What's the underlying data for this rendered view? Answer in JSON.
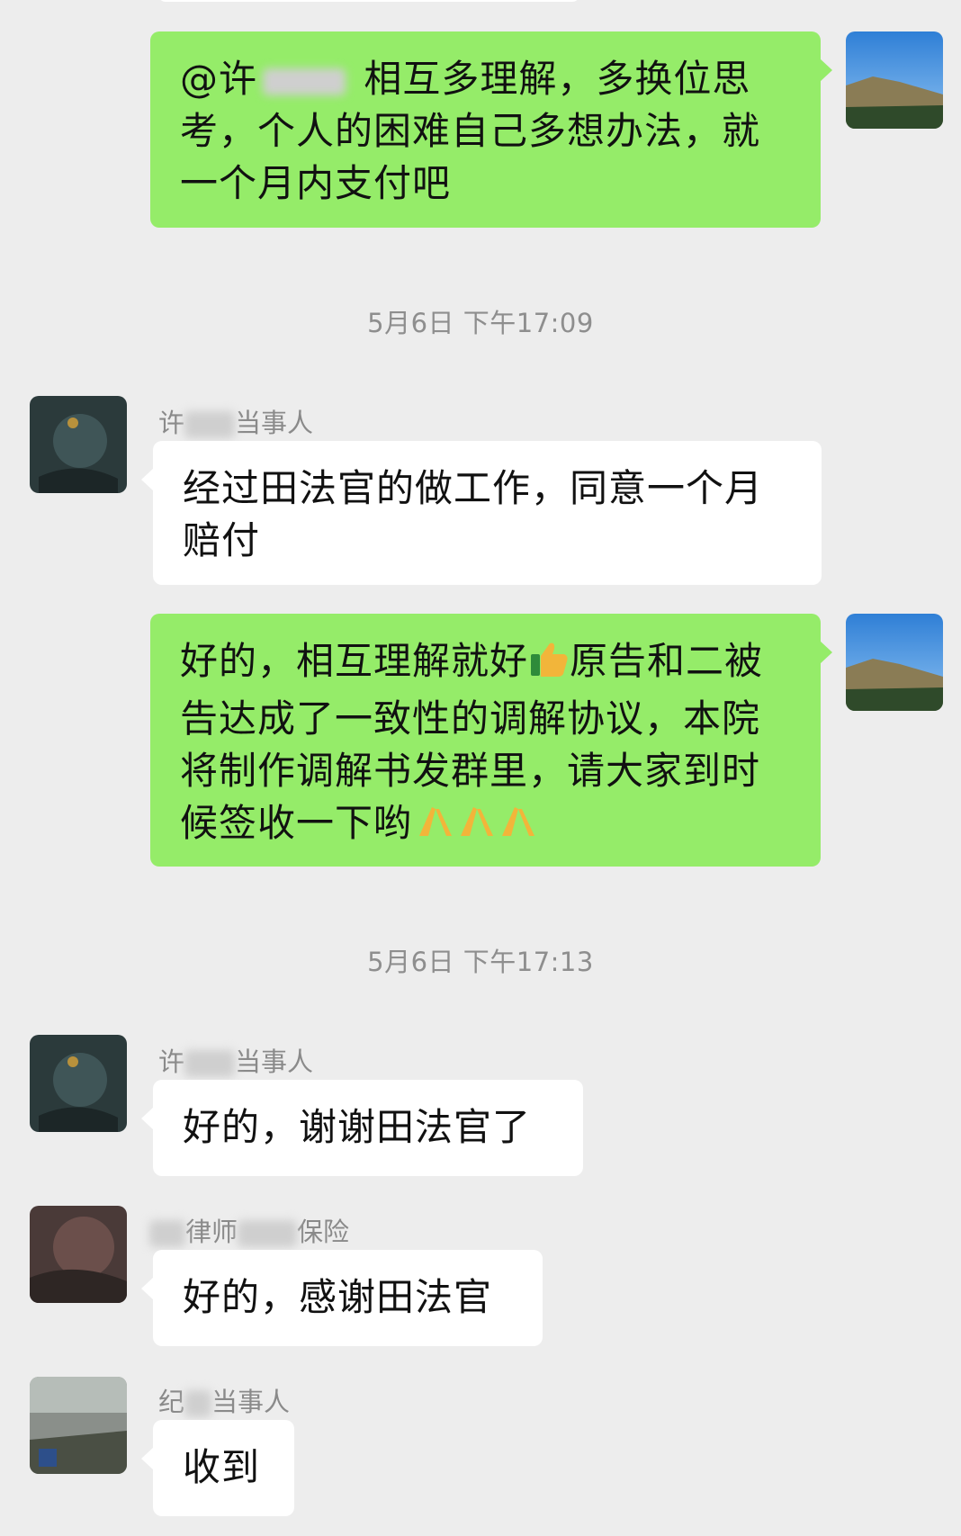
{
  "messages": [
    {
      "type": "out",
      "mention": "@许",
      "text": "相互多理解，多换位思考，个人的困难自己多想办法，就一个月内支付吧"
    },
    {
      "type": "time",
      "text": "5月6日 下午17:09"
    },
    {
      "type": "in",
      "sender_prefix": "许",
      "sender_suffix": "当事人",
      "text": "经过田法官的做工作，同意一个月赔付"
    },
    {
      "type": "out",
      "text_part1": "好的，相互理解就好",
      "emoji1": "thumbs-up",
      "text_part2": "原告和二被告达成了一致性的调解协议，本院将制作调解书发群里，请大家到时候签收一下哟",
      "emoji2": "folded-hands"
    },
    {
      "type": "time",
      "text": "5月6日 下午17:13"
    },
    {
      "type": "in",
      "sender_prefix": "许",
      "sender_suffix": "当事人",
      "text": "好的，谢谢田法官了"
    },
    {
      "type": "in",
      "sender_mid": "律师",
      "sender_suffix": "保险",
      "text": "好的，感谢田法官"
    },
    {
      "type": "in",
      "sender_prefix": "纪",
      "sender_suffix": "当事人",
      "text": "收到"
    }
  ],
  "colors": {
    "background": "#ededed",
    "outgoing_bubble": "#95ec69",
    "incoming_bubble": "#ffffff",
    "meta_text": "#8e8e8e"
  }
}
